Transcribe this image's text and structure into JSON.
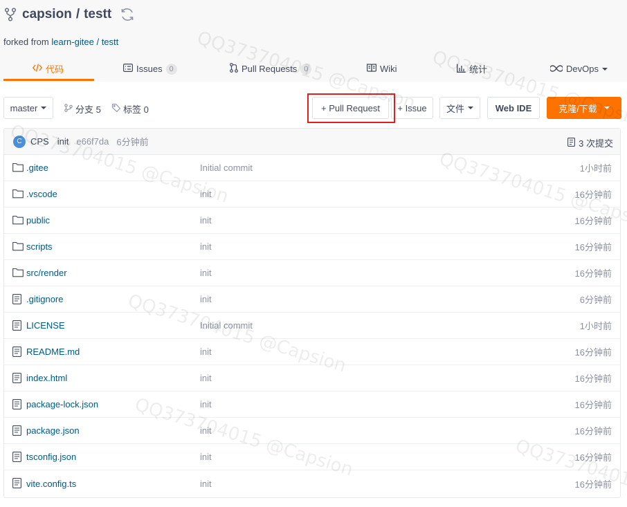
{
  "repo": {
    "owner": "capsion",
    "separator": "/",
    "name": "testt",
    "forked_prefix": "forked from",
    "forked_owner": "learn-gitee",
    "forked_sep": "/",
    "forked_repo": "testt"
  },
  "tabs": [
    {
      "label": "代码",
      "icon": "code-icon",
      "active": true
    },
    {
      "label": "Issues",
      "icon": "issues-icon",
      "badge": "0"
    },
    {
      "label": "Pull Requests",
      "icon": "pull-request-icon",
      "badge": "0"
    },
    {
      "label": "Wiki",
      "icon": "book-icon"
    },
    {
      "label": "统计",
      "icon": "bar-chart-icon"
    },
    {
      "label": "DevOps",
      "icon": "infinity-icon"
    }
  ],
  "toolbar": {
    "branch": "master",
    "branches_label": "分支 5",
    "tags_label": "标签 0",
    "pull_request_label": "+ Pull Request",
    "issue_label": "+ Issue",
    "file_label": "文件",
    "webide_label": "Web IDE",
    "clone_label": "克隆/下载"
  },
  "commit": {
    "avatar_letter": "C",
    "author": "CPS",
    "message": "init",
    "sha": "e66f7da",
    "time": "6分钟前",
    "count_label": "3 次提交"
  },
  "files": [
    {
      "name": ".gitee",
      "type": "folder",
      "message": "Initial commit",
      "time": "1小时前"
    },
    {
      "name": ".vscode",
      "type": "folder",
      "message": "init",
      "time": "16分钟前"
    },
    {
      "name": "public",
      "type": "folder",
      "message": "init",
      "time": "16分钟前"
    },
    {
      "name": "scripts",
      "type": "folder",
      "message": "init",
      "time": "16分钟前"
    },
    {
      "name": "src/render",
      "type": "folder",
      "message": "init",
      "time": "16分钟前"
    },
    {
      "name": ".gitignore",
      "type": "file",
      "message": "init",
      "time": "6分钟前"
    },
    {
      "name": "LICENSE",
      "type": "file",
      "message": "Initial commit",
      "time": "1小时前"
    },
    {
      "name": "README.md",
      "type": "file",
      "message": "init",
      "time": "16分钟前"
    },
    {
      "name": "index.html",
      "type": "file",
      "message": "init",
      "time": "16分钟前"
    },
    {
      "name": "package-lock.json",
      "type": "file",
      "message": "init",
      "time": "16分钟前"
    },
    {
      "name": "package.json",
      "type": "file",
      "message": "init",
      "time": "16分钟前"
    },
    {
      "name": "tsconfig.json",
      "type": "file",
      "message": "init",
      "time": "16分钟前"
    },
    {
      "name": "vite.config.ts",
      "type": "file",
      "message": "init",
      "time": "16分钟前"
    }
  ],
  "watermark_text": "QQ373704015 @Capsion",
  "colors": {
    "accent": "#fe7300",
    "link": "#005980",
    "highlight": "#e0201f"
  }
}
